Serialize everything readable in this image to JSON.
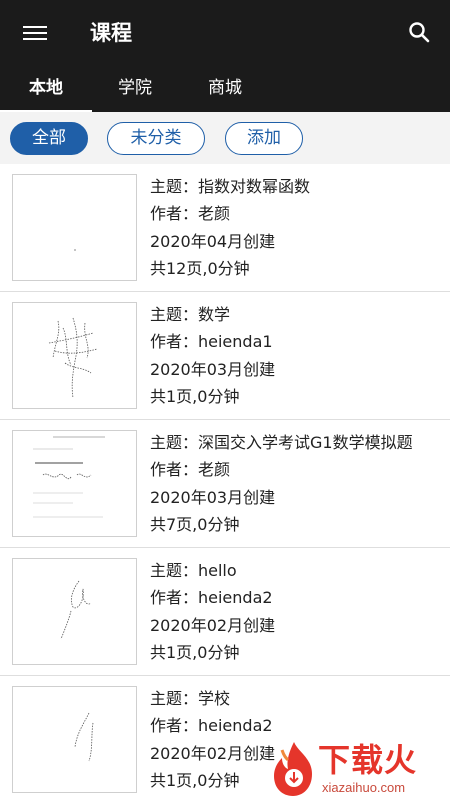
{
  "appbar": {
    "title": "课程",
    "menu_icon": "hamburger-menu-icon",
    "search_icon": "search-icon",
    "background": "#1b1b1b"
  },
  "tabs": [
    {
      "label": "本地",
      "selected": true
    },
    {
      "label": "学院",
      "selected": false
    },
    {
      "label": "商城",
      "selected": false
    }
  ],
  "filters": [
    {
      "label": "全部",
      "selected": true
    },
    {
      "label": "未分类",
      "selected": false
    },
    {
      "label": "添加",
      "selected": false
    }
  ],
  "accent_color": "#1f5fa8",
  "courses": [
    {
      "topic": "主题：指数对数幂函数",
      "author": "作者：老颜",
      "created": "2020年04月创建",
      "summary": "共12页,0分钟"
    },
    {
      "topic": "主题：数学",
      "author": "作者：heienda1",
      "created": "2020年03月创建",
      "summary": "共1页,0分钟"
    },
    {
      "topic": "主题：深国交入学考试G1数学模拟题",
      "author": "作者：老颜",
      "created": "2020年03月创建",
      "summary": "共7页,0分钟"
    },
    {
      "topic": "主题：hello",
      "author": "作者：heienda2",
      "created": "2020年02月创建",
      "summary": "共1页,0分钟"
    },
    {
      "topic": "主题：学校",
      "author": "作者：heienda2",
      "created": "2020年02月创建",
      "summary": "共1页,0分钟"
    }
  ],
  "watermark": {
    "text": "下载火",
    "sub": "xiazaihuo.com",
    "color": "#e5352b"
  }
}
